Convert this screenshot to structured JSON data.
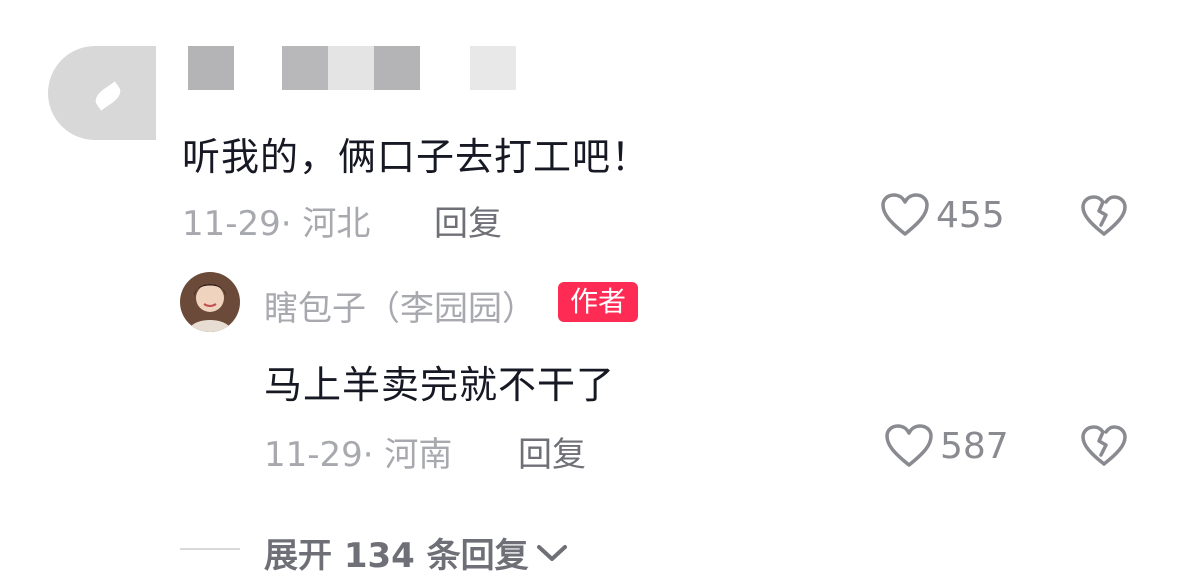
{
  "comment": {
    "text": "听我的，俩口子去打工吧！",
    "meta": "11-29· 河北",
    "reply_label": "回复",
    "likes": "455"
  },
  "reply": {
    "author": "瞎包子（李园园）",
    "author_badge": "作者",
    "text": "马上羊卖完就不干了",
    "meta": "11-29· 河南",
    "reply_label": "回复",
    "likes": "587"
  },
  "expand": {
    "label": "展开 134 条回复"
  },
  "colors": {
    "badge": "#fe2c55",
    "primary_text": "#161823",
    "secondary_text": "#a7a9ae"
  },
  "icons": {
    "like": "heart-outline-icon",
    "dislike": "broken-heart-icon",
    "expand": "chevron-down-icon"
  }
}
